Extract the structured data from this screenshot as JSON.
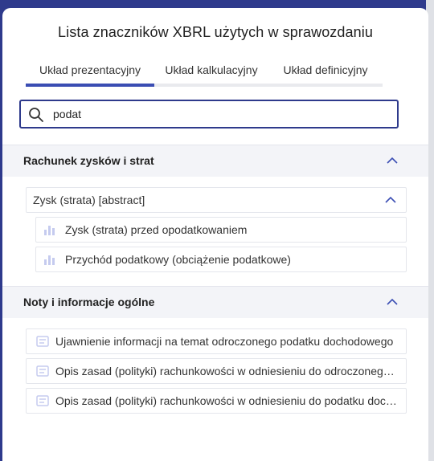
{
  "dialog": {
    "title": "Lista znaczników XBRL użytych w sprawozdaniu"
  },
  "tabs": [
    {
      "label": "Układ prezentacyjny",
      "active": true
    },
    {
      "label": "Układ kalkulacyjny",
      "active": false
    },
    {
      "label": "Układ definicyjny",
      "active": false
    }
  ],
  "search": {
    "value": "podat",
    "icon": "search-icon"
  },
  "sections": [
    {
      "label": "Rachunek zysków i strat",
      "expanded": true,
      "groups": [
        {
          "label": "Zysk (strata) [abstract]",
          "expanded": true,
          "items": [
            {
              "label": "Zysk (strata) przed opodatkowaniem",
              "icon": "bar-chart-icon"
            },
            {
              "label": "Przychód podatkowy (obciążenie podatkowe)",
              "icon": "bar-chart-icon"
            }
          ]
        }
      ]
    },
    {
      "label": "Noty i informacje ogólne",
      "expanded": true,
      "items": [
        {
          "label": "Ujawnienie informacji na temat odroczonego podatku dochodowego",
          "icon": "text-block-icon"
        },
        {
          "label": "Opis zasad (polityki) rachunkowości w odniesieniu do odroczonego podatku",
          "icon": "text-block-icon"
        },
        {
          "label": "Opis zasad (polityki) rachunkowości w odniesieniu do podatku dochodowego",
          "icon": "text-block-icon"
        }
      ]
    }
  ],
  "colors": {
    "accent": "#3a4db3",
    "backdrop": "#2e3a8c",
    "section_bg": "#f3f4f8",
    "icon_muted": "#c5cbef"
  }
}
